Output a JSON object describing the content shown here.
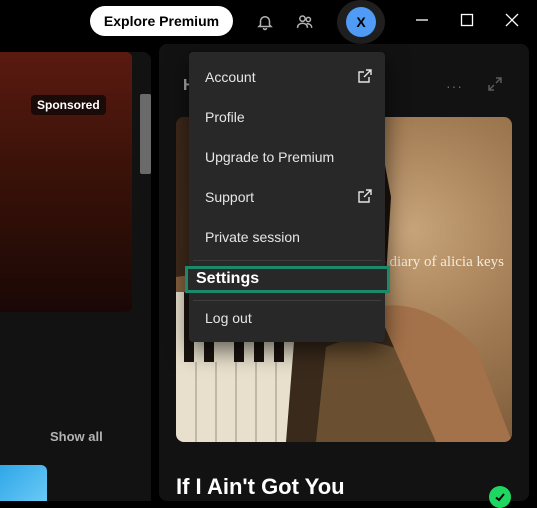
{
  "topbar": {
    "explore_premium_label": "Explore Premium",
    "avatar_initial": "X"
  },
  "left_panel": {
    "sponsored_label": "Sponsored",
    "show_all_label": "Show all"
  },
  "right_panel": {
    "heading_initial": "H",
    "more_label": "···",
    "cover_text": "the diary of alicia keys",
    "song_title": "If I Ain't Got You"
  },
  "menu": {
    "items": [
      {
        "label": "Account",
        "external": true
      },
      {
        "label": "Profile",
        "external": false
      },
      {
        "label": "Upgrade to Premium",
        "external": false
      },
      {
        "label": "Support",
        "external": true
      },
      {
        "label": "Private session",
        "external": false
      },
      {
        "label": "Settings",
        "external": false,
        "highlighted": true
      },
      {
        "label": "Log out",
        "external": false
      }
    ]
  },
  "colors": {
    "accent_green": "#1ed760",
    "highlight_border": "#1a8a6a",
    "avatar_blue": "#509bf5",
    "menu_bg": "#282828"
  }
}
